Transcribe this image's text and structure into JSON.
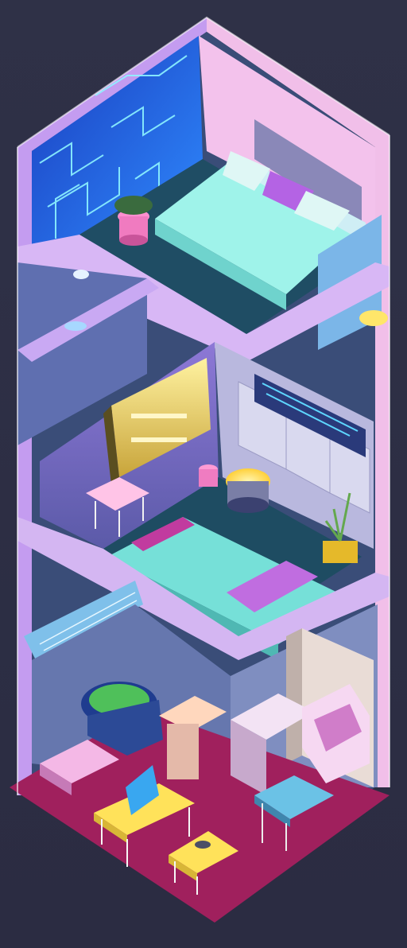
{
  "scene": {
    "colors": {
      "background": "#2f3147",
      "wall_pink": "#f3c6ef",
      "wall_purple": "#a57ee8",
      "floor_teal": "#26506b",
      "neon_cyan": "#7ff0e8",
      "neon_blue": "#2d7dff",
      "accent_yellow": "#ffe25a",
      "floor_magenta": "#a0205d"
    },
    "levels": [
      {
        "name": "top-bedroom",
        "objects": [
          "bed-icon",
          "pillow-icon",
          "plant-pot-icon",
          "neon-circuit-wall-icon",
          "window-icon"
        ]
      },
      {
        "name": "middle-bedroom",
        "objects": [
          "bed-icon",
          "closet-icon",
          "stool-icon",
          "plant-icon",
          "side-table-icon",
          "lamp-icon"
        ]
      },
      {
        "name": "ground-studio",
        "objects": [
          "armchair-icon",
          "desk-icon",
          "coffee-table-icon",
          "laptop-icon",
          "cabinet-icon",
          "couch-icon"
        ]
      }
    ]
  }
}
